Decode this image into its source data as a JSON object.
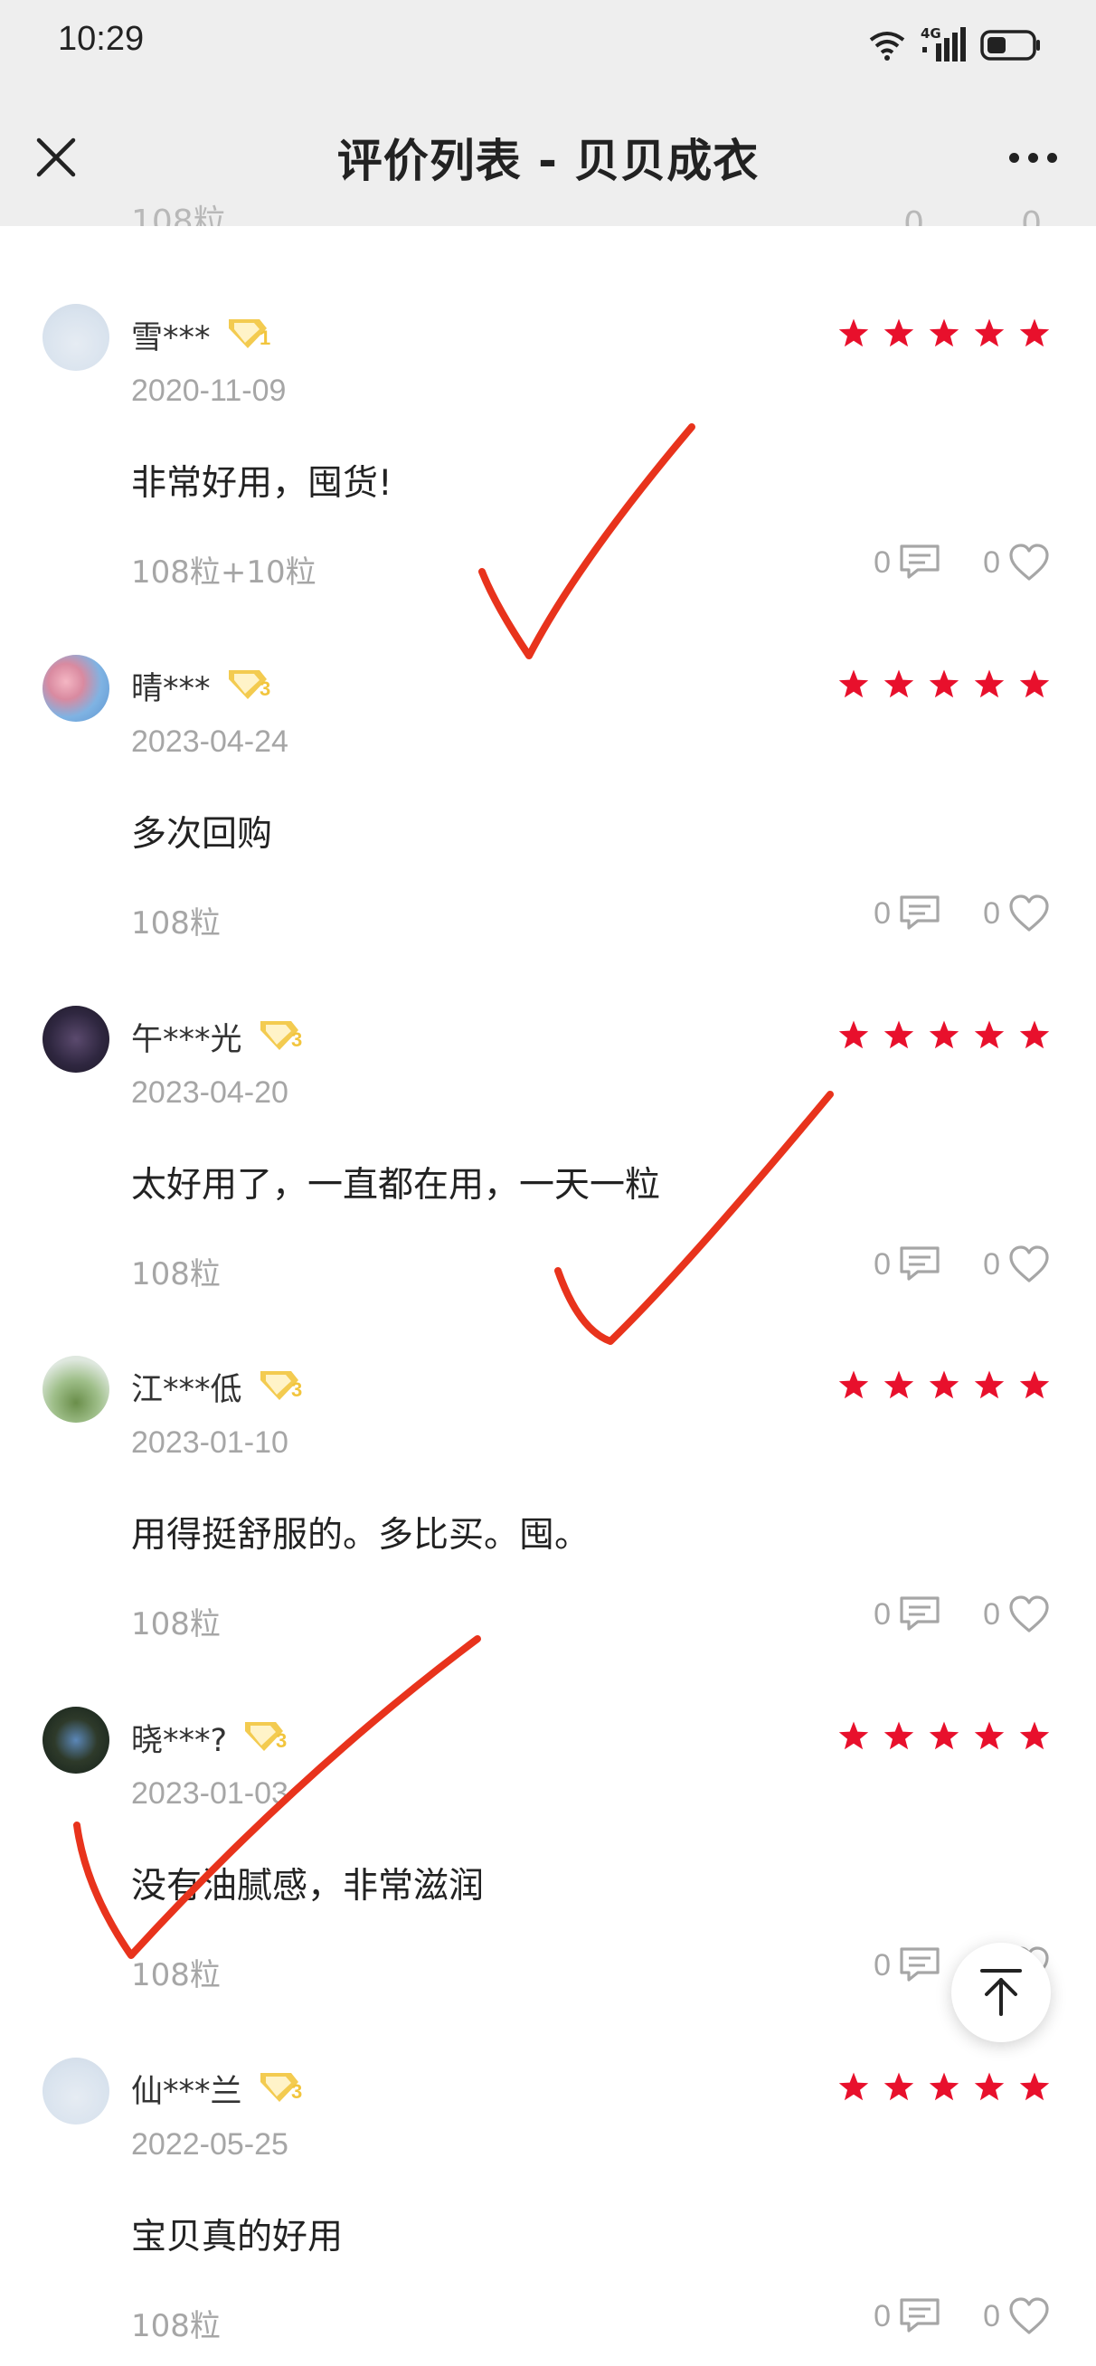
{
  "status": {
    "time": "10:29",
    "network": "4G"
  },
  "nav": {
    "title": "评价列表 - 贝贝成衣"
  },
  "partial_top": {
    "spec": "108粒",
    "comments": "0",
    "likes": "0"
  },
  "reviews": [
    {
      "user": "雪***",
      "level": "V1",
      "rating": 5,
      "date": "2020-11-09",
      "content": "非常好用，囤货!",
      "spec": "108粒+10粒",
      "comments": "0",
      "likes": "0"
    },
    {
      "user": "晴***",
      "level": "V3",
      "rating": 5,
      "date": "2023-04-24",
      "content": "多次回购",
      "spec": "108粒",
      "comments": "0",
      "likes": "0"
    },
    {
      "user": "午***光",
      "level": "V3",
      "rating": 5,
      "date": "2023-04-20",
      "content": "太好用了，一直都在用，一天一粒",
      "spec": "108粒",
      "comments": "0",
      "likes": "0"
    },
    {
      "user": "江***低",
      "level": "V3",
      "rating": 5,
      "date": "2023-01-10",
      "content": "用得挺舒服的。多比买。囤。",
      "spec": "108粒",
      "comments": "0",
      "likes": "0"
    },
    {
      "user": "晓***?",
      "level": "V3",
      "rating": 5,
      "date": "2023-01-03",
      "content": "没有油腻感，非常滋润",
      "spec": "108粒",
      "comments": "0",
      "likes": "0"
    },
    {
      "user": "仙***兰",
      "level": "V3",
      "rating": 5,
      "date": "2022-05-25",
      "content": "宝贝真的好用",
      "spec": "108粒",
      "comments": "0",
      "likes": "0"
    }
  ],
  "colors": {
    "star": "#e8102c",
    "badge_gold": "#f2c53d",
    "annotation": "#e8331c",
    "navbar_bg": "#eeeeee"
  },
  "icons": {
    "close": "close-icon",
    "more": "more-icon",
    "comment": "comment-icon",
    "like": "heart-icon",
    "back_to_top": "arrow-up-icon",
    "star": "star-icon",
    "level": "vip-badge-icon"
  }
}
